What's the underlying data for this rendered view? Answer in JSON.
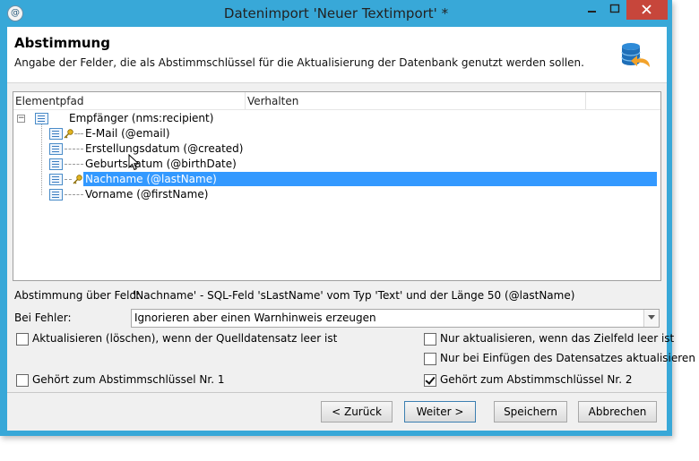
{
  "window": {
    "title": "Datenimport 'Neuer Textimport' *"
  },
  "header": {
    "title": "Abstimmung",
    "subtitle": "Angabe der Felder, die als Abstimmschlüssel für die Aktualisierung der Datenbank genutzt werden sollen."
  },
  "tree": {
    "columns": [
      "Elementpfad",
      "Verhalten"
    ],
    "root": {
      "label": "Empfänger (nms:recipient)",
      "expanded": true
    },
    "children": [
      {
        "label": "E-Mail (@email)",
        "key": true,
        "selected": false
      },
      {
        "label": "Erstellungsdatum (@created)",
        "key": false,
        "selected": false
      },
      {
        "label": "Geburtsdatum (@birthDate)",
        "key": false,
        "selected": false
      },
      {
        "label": "Nachname (@lastName)",
        "key": true,
        "selected": true
      },
      {
        "label": "Vorname (@firstName)",
        "key": false,
        "selected": false
      }
    ]
  },
  "reconciliation": {
    "label": "Abstimmung über Feld:",
    "value": "'Nachname' - SQL-Feld 'sLastName' vom Typ 'Text' und der Länge 50 (@lastName)"
  },
  "on_error": {
    "label": "Bei Fehler:",
    "selected": "Ignorieren aber einen Warnhinweis erzeugen"
  },
  "options": {
    "update_delete_empty": {
      "label": "Aktualisieren (löschen), wenn der Quelldatensatz leer ist",
      "checked": false
    },
    "update_if_target_empty": {
      "label": "Nur aktualisieren, wenn das Zielfeld leer ist",
      "checked": false
    },
    "update_on_insert": {
      "label": "Nur bei Einfügen des Datensatzes aktualisieren",
      "checked": false
    },
    "key_1": {
      "label": "Gehört zum Abstimmschlüssel Nr. 1",
      "checked": false
    },
    "key_2": {
      "label": "Gehört zum Abstimmschlüssel Nr. 2",
      "checked": true
    }
  },
  "buttons": {
    "back": "< Zurück",
    "next": "Weiter >",
    "save": "Speichern",
    "cancel": "Abbrechen"
  },
  "colors": {
    "titlebar": "#38a8d8",
    "selection": "#3399ff",
    "close": "#c7463b"
  },
  "icons": [
    "app-icon",
    "minimize-icon",
    "maximize-icon",
    "close-icon",
    "database-refresh-icon",
    "tree-collapse-icon",
    "list-node-icon",
    "key-icon",
    "mouse-cursor-icon"
  ]
}
